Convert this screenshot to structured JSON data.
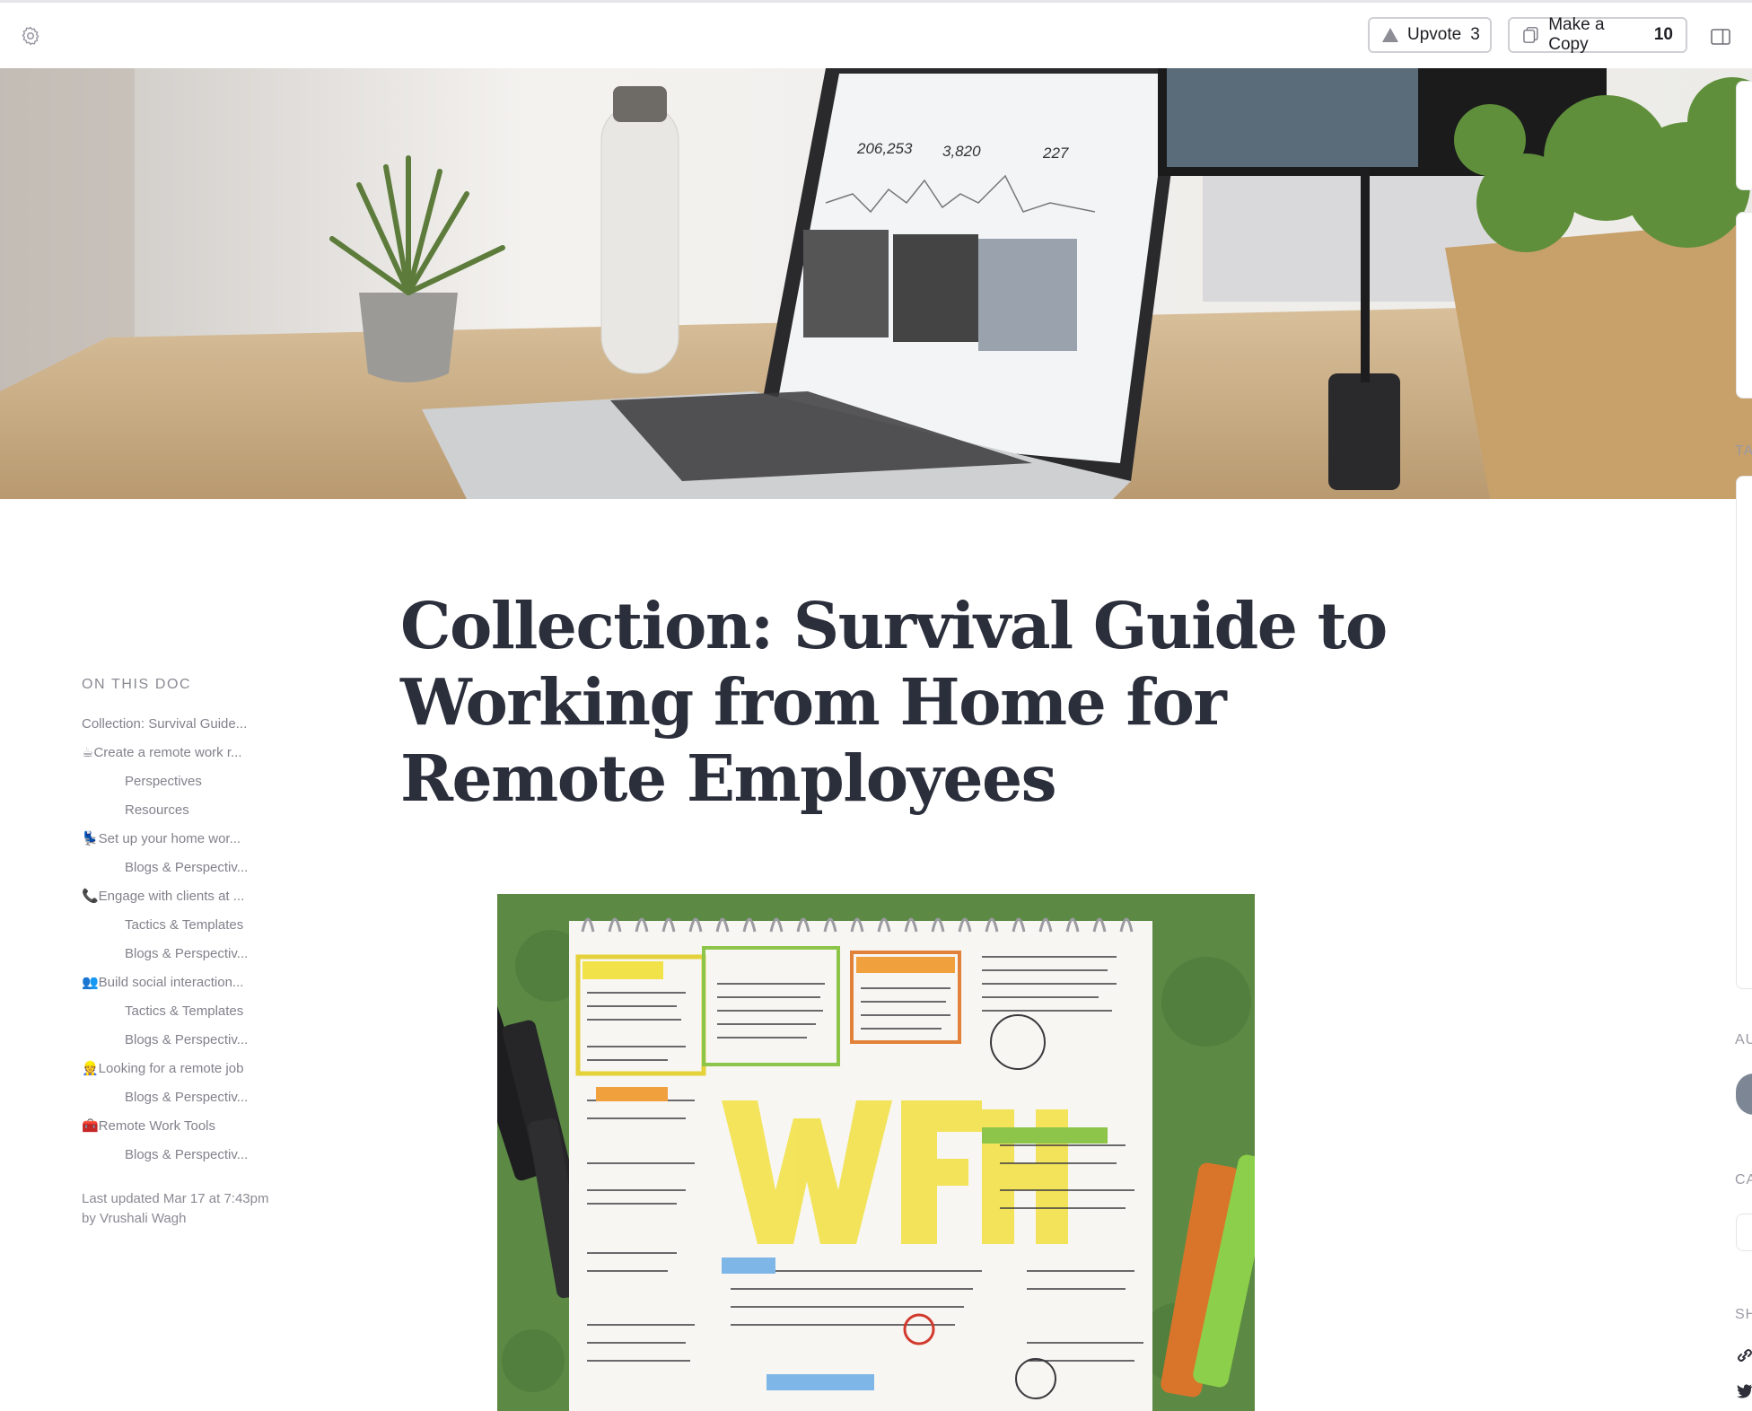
{
  "toolbar": {
    "upvote_label": "Upvote",
    "upvote_count": "3",
    "copy_label": "Make a Copy",
    "copy_count": "10"
  },
  "hero": {
    "stats": [
      "206,253",
      "3,820",
      "227"
    ]
  },
  "toc": {
    "heading": "ON THIS DOC",
    "items": [
      {
        "label": "Collection: Survival Guide..."
      },
      {
        "label": "☕Create a remote work r..."
      },
      {
        "label": "Perspectives"
      },
      {
        "label": "Resources"
      },
      {
        "label": "💺Set up your home wor..."
      },
      {
        "label": "Blogs & Perspectiv..."
      },
      {
        "label": "📞Engage with clients at ..."
      },
      {
        "label": "Tactics & Templates"
      },
      {
        "label": "Blogs & Perspectiv..."
      },
      {
        "label": "👥Build social interaction..."
      },
      {
        "label": "Tactics & Templates"
      },
      {
        "label": "Blogs & Perspectiv..."
      },
      {
        "label": "👷Looking for a remote job"
      },
      {
        "label": "Blogs & Perspectiv..."
      },
      {
        "label": "🧰Remote Work Tools"
      },
      {
        "label": "Blogs & Perspectiv..."
      }
    ],
    "updated": "Last updated Mar 17 at 7:43pm by Vrushali Wagh"
  },
  "doc": {
    "title": "Collection: Survival Guide to Working from Home for Remote Employees"
  },
  "right_sidebar": {
    "labels": [
      "TA",
      "AU",
      "CA",
      "SH"
    ]
  },
  "colors": {
    "title": "#2b2e3b",
    "toc_text": "#82828c",
    "button_border": "#cfcfd4",
    "sketch_green": "#5c8a45",
    "highlight_yellow": "#f2e24a"
  },
  "icons": {
    "settings": "gear-icon",
    "upvote": "triangle-up-icon",
    "copy": "copy-icon",
    "panel": "sidebar-toggle-icon",
    "link": "link-icon",
    "twitter": "twitter-icon"
  }
}
